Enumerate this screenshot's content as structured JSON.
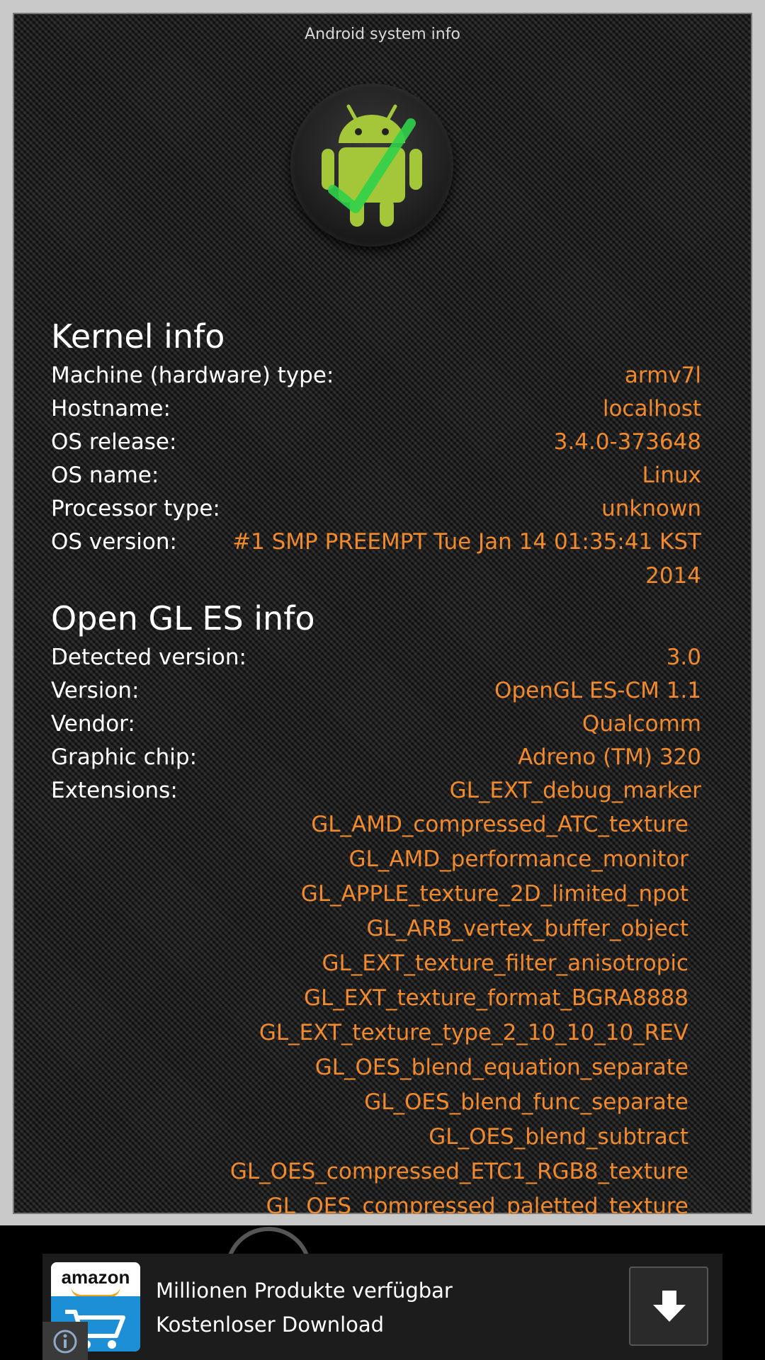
{
  "app": {
    "title": "Android system info"
  },
  "kernel": {
    "title": "Kernel info",
    "rows": [
      {
        "label": "Machine (hardware) type:",
        "value": "armv7l"
      },
      {
        "label": "Hostname:",
        "value": "localhost"
      },
      {
        "label": "OS release:",
        "value": "3.4.0-373648"
      },
      {
        "label": "OS name:",
        "value": "Linux"
      },
      {
        "label": "Processor type:",
        "value": "unknown"
      },
      {
        "label": "OS version:",
        "value": "#1 SMP PREEMPT Tue Jan 14 01:35:41 KST",
        "value_line2": "2014"
      }
    ]
  },
  "opengl": {
    "title": "Open GL ES info",
    "rows": [
      {
        "label": "Detected version:",
        "value": "3.0"
      },
      {
        "label": "Version:",
        "value": "OpenGL ES-CM 1.1"
      },
      {
        "label": "Vendor:",
        "value": "Qualcomm"
      },
      {
        "label": "Graphic chip:",
        "value": "Adreno (TM) 320"
      },
      {
        "label": "Extensions:",
        "value": "GL_EXT_debug_marker"
      }
    ],
    "extensions": [
      "GL_AMD_compressed_ATC_texture",
      "GL_AMD_performance_monitor",
      "GL_APPLE_texture_2D_limited_npot",
      "GL_ARB_vertex_buffer_object",
      "GL_EXT_texture_filter_anisotropic",
      "GL_EXT_texture_format_BGRA8888",
      "GL_EXT_texture_type_2_10_10_10_REV",
      "GL_OES_blend_equation_separate",
      "GL_OES_blend_func_separate",
      "GL_OES_blend_subtract",
      "GL_OES_compressed_ETC1_RGB8_texture",
      "GL_OES_compressed_paletted_texture"
    ]
  },
  "ad": {
    "logo_text": "amazon",
    "text": "Millionen Produkte verfügbar Kostenloser Download",
    "download_icon": "download-arrow-icon",
    "info_icon": "info-icon"
  },
  "colors": {
    "value": "#f08a2c",
    "label": "#ffffff",
    "ad_blue": "#1d8fd6",
    "ad_orange": "#f3a31c"
  }
}
